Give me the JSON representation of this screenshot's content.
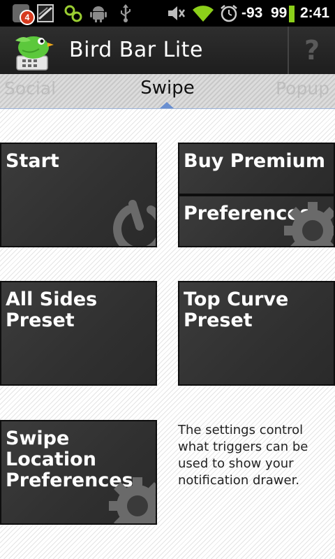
{
  "status_bar": {
    "notification_count": "4",
    "signal": "-93",
    "battery": "99",
    "time": "2:41"
  },
  "action_bar": {
    "title": "Bird Bar Lite",
    "help_label": "?"
  },
  "pager": {
    "tabs": [
      "Social",
      "Swipe",
      "Popup"
    ],
    "active_tab": "Swipe"
  },
  "tiles": {
    "start": "Start",
    "buy_premium": "Buy Premium",
    "preferences": "Preferences",
    "all_sides_preset": "All Sides Preset",
    "top_curve_preset": "Top Curve Preset",
    "swipe_location_preferences": "Swipe Location Preferences"
  },
  "info_text": "The settings control what triggers can be used to show your notification drawer.",
  "colors": {
    "status_bar_bg": "#000000",
    "action_bar_bg": "#262626",
    "tile_bg": "#353535",
    "tab_indicator": "#6a8fd0",
    "badge_red": "#d63a1e",
    "wifi_green": "#8ccf1a",
    "bird_green": "#5cc83c"
  },
  "icons": {
    "status": [
      "notification-app-icon",
      "battery-bars-icon",
      "link-icon",
      "android-icon",
      "usb-icon",
      "mute-icon",
      "wifi-icon",
      "alarm-icon",
      "battery-icon"
    ],
    "tiles": [
      "power-icon",
      "gear-icon"
    ]
  }
}
